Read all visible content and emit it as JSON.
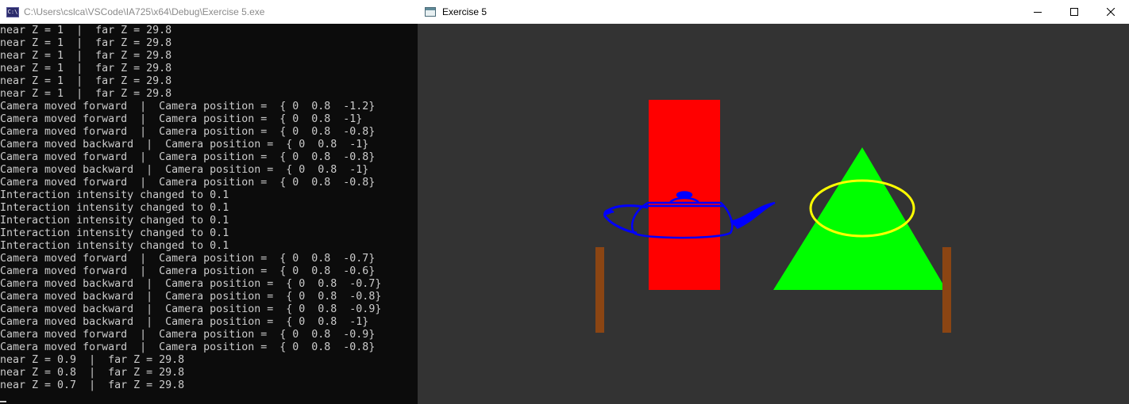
{
  "console_window": {
    "title": "C:\\Users\\cslca\\VSCode\\IA725\\x64\\Debug\\Exercise 5.exe",
    "icon": "console-app-icon",
    "icon_text": "C:\\",
    "lines": [
      "near Z = 1  |  far Z = 29.8",
      "near Z = 1  |  far Z = 29.8",
      "near Z = 1  |  far Z = 29.8",
      "near Z = 1  |  far Z = 29.8",
      "near Z = 1  |  far Z = 29.8",
      "near Z = 1  |  far Z = 29.8",
      "Camera moved forward  |  Camera position =  { 0  0.8  -1.2}",
      "Camera moved forward  |  Camera position =  { 0  0.8  -1}",
      "Camera moved forward  |  Camera position =  { 0  0.8  -0.8}",
      "Camera moved backward  |  Camera position =  { 0  0.8  -1}",
      "Camera moved forward  |  Camera position =  { 0  0.8  -0.8}",
      "Camera moved backward  |  Camera position =  { 0  0.8  -1}",
      "Camera moved forward  |  Camera position =  { 0  0.8  -0.8}",
      "Interaction intensity changed to 0.1",
      "Interaction intensity changed to 0.1",
      "Interaction intensity changed to 0.1",
      "Interaction intensity changed to 0.1",
      "Interaction intensity changed to 0.1",
      "Camera moved forward  |  Camera position =  { 0  0.8  -0.7}",
      "Camera moved forward  |  Camera position =  { 0  0.8  -0.6}",
      "Camera moved backward  |  Camera position =  { 0  0.8  -0.7}",
      "Camera moved backward  |  Camera position =  { 0  0.8  -0.8}",
      "Camera moved backward  |  Camera position =  { 0  0.8  -0.9}",
      "Camera moved backward  |  Camera position =  { 0  0.8  -1}",
      "Camera moved forward  |  Camera position =  { 0  0.8  -0.9}",
      "Camera moved forward  |  Camera position =  { 0  0.8  -0.8}",
      "near Z = 0.9  |  far Z = 29.8",
      "near Z = 0.8  |  far Z = 29.8",
      "near Z = 0.7  |  far Z = 29.8"
    ]
  },
  "gl_window": {
    "title": "Exercise 5",
    "icon": "window-app-icon",
    "controls": {
      "minimize_icon": "minimize-icon",
      "maximize_icon": "maximize-icon",
      "close_icon": "close-icon"
    },
    "scene": {
      "background": "#333333",
      "objects": [
        {
          "name": "red-rectangle",
          "color": "#ff0000"
        },
        {
          "name": "blue-wireframe-teapot",
          "color": "#0000ff"
        },
        {
          "name": "green-triangle",
          "color": "#00ff00"
        },
        {
          "name": "yellow-ellipse-outline",
          "color": "#ffff00"
        },
        {
          "name": "left-brown-post",
          "color": "#8b4513"
        },
        {
          "name": "right-brown-post",
          "color": "#8b4513"
        }
      ]
    }
  }
}
